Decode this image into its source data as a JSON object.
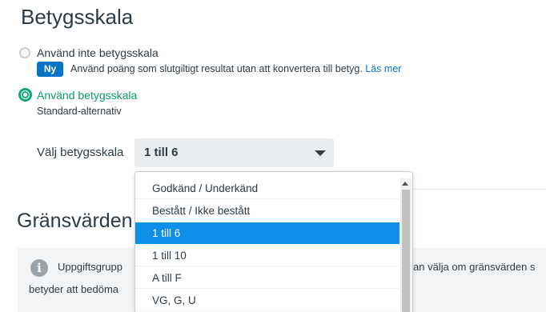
{
  "page": {
    "title": "Betygsskala"
  },
  "options": {
    "no_scale": {
      "label": "Använd inte betygsskala",
      "badge": "Ny",
      "description": "Använd poäng som slutgiltigt resultat utan att konvertera till betyg.",
      "link": "Läs mer"
    },
    "use_scale": {
      "label": "Använd betygsskala",
      "sublabel": "Standard-alternativ"
    }
  },
  "select": {
    "label": "Välj betygsskala",
    "value": "1 till 6",
    "options": [
      "Godkänd / Underkänd",
      "Bestått / Ikke bestått",
      "1 till 6",
      "1 till 10",
      "A till F",
      "VG, G, U"
    ],
    "selected_index": 2
  },
  "thresholds": {
    "title": "Gränsvärden",
    "info_line1": "Uppgiftsgrupp",
    "info_line1_right": "an välja om gränsvärden s",
    "info_line2": "betyder att bedöma"
  }
}
